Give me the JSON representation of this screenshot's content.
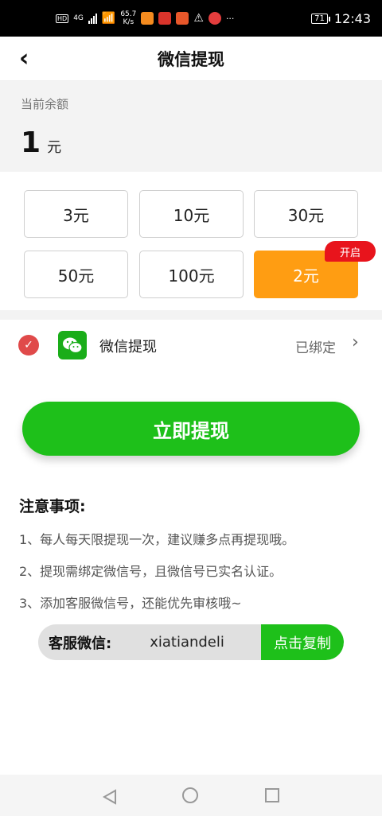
{
  "status_bar": {
    "network_label": "HD",
    "network_type": "4G",
    "speed_value": "65.7",
    "speed_unit": "K/s",
    "more": "···",
    "battery": "71",
    "time": "12:43"
  },
  "header": {
    "title": "微信提现",
    "back_icon": "chevron-left-icon"
  },
  "balance": {
    "label": "当前余额",
    "amount": "1",
    "unit": "元"
  },
  "amounts": [
    {
      "label": "3元",
      "selected": false
    },
    {
      "label": "10元",
      "selected": false
    },
    {
      "label": "30元",
      "selected": false
    },
    {
      "label": "50元",
      "selected": false
    },
    {
      "label": "100元",
      "selected": false
    },
    {
      "label": "2元",
      "selected": true
    }
  ],
  "amount_badge": "开启",
  "payment": {
    "name": "微信提现",
    "status": "已绑定",
    "icon": "wechat-icon",
    "chevron": "›",
    "check_icon": "check-circle-icon"
  },
  "withdraw_button": "立即提现",
  "notes": {
    "title": "注意事项:",
    "items": [
      "1、每人每天限提现一次，建议赚多点再提现哦。",
      "2、提现需绑定微信号，且微信号已实名认证。",
      "3、添加客服微信号，还能优先审核哦~"
    ]
  },
  "service": {
    "label": "客服微信:",
    "wechat_id": "xiatiandeli",
    "copy_button": "点击复制"
  },
  "colors": {
    "selected_amount": "#ff9d12",
    "accent_green": "#1ec01a",
    "badge_red": "#e8141c"
  }
}
